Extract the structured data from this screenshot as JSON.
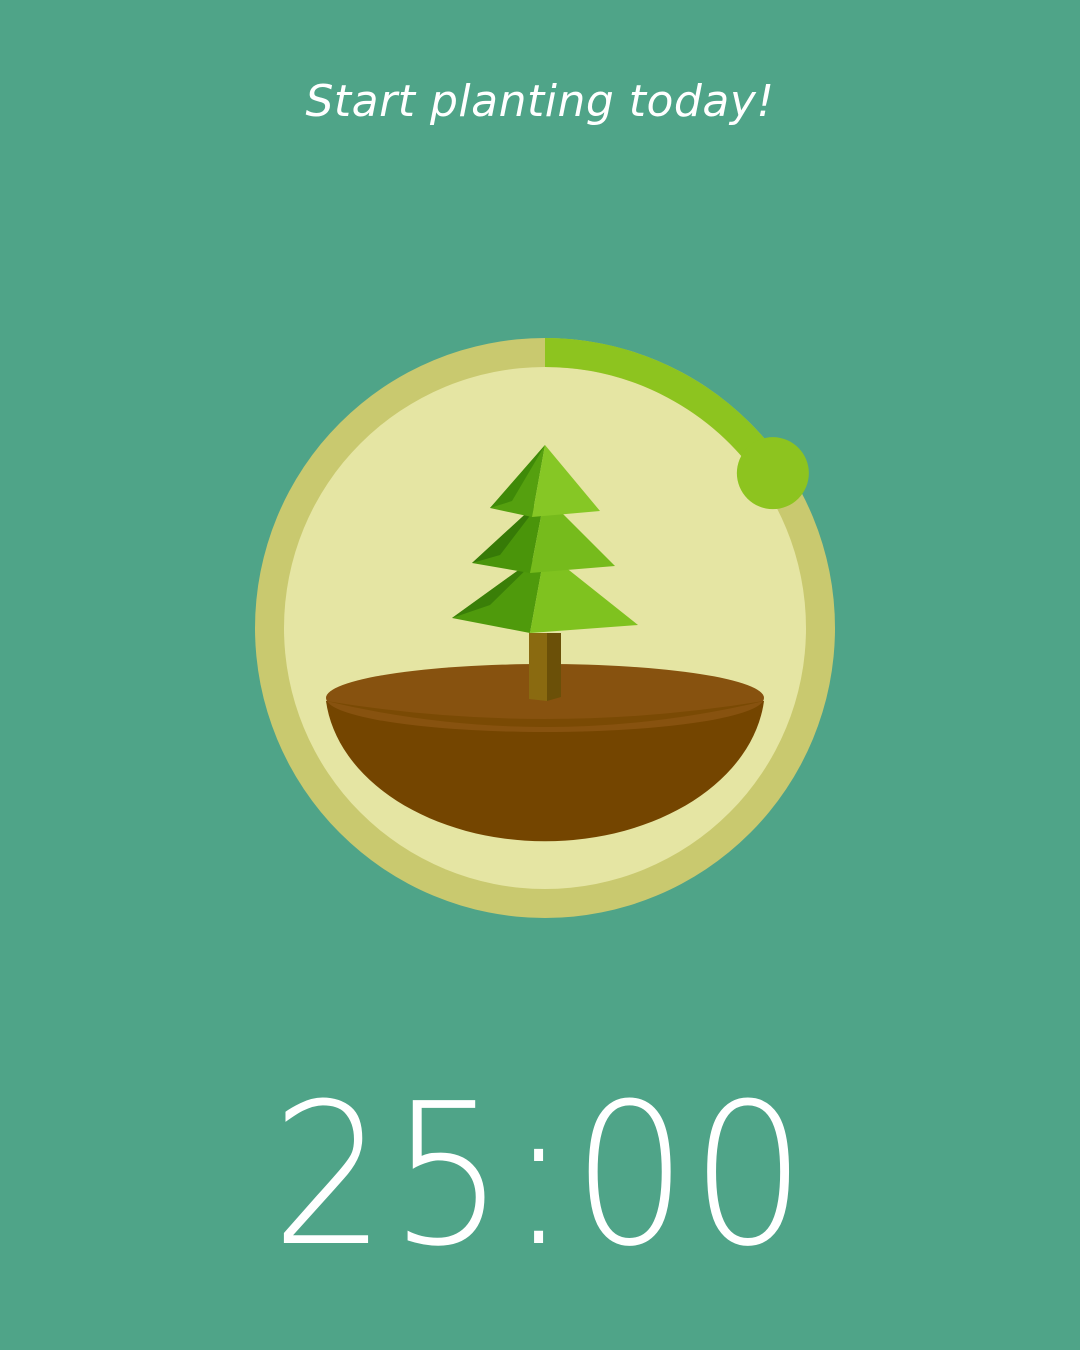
{
  "header": {
    "subtitle": "Start planting today!"
  },
  "timer": {
    "display": "25:00",
    "progress_fraction": 0.155
  },
  "plant": {
    "kind": "pine-tree",
    "icon_name": "tree-icon"
  },
  "colors": {
    "background": "#4fa488",
    "ring_track": "#c9c96f",
    "ring_progress": "#8dc41f",
    "dial_inner": "#e5e5a3",
    "soil_top": "#87520f",
    "soil_body": "#744500",
    "tree_light": "#7fc21f",
    "tree_dark": "#3f8f0a",
    "trunk": "#8a6a10"
  }
}
